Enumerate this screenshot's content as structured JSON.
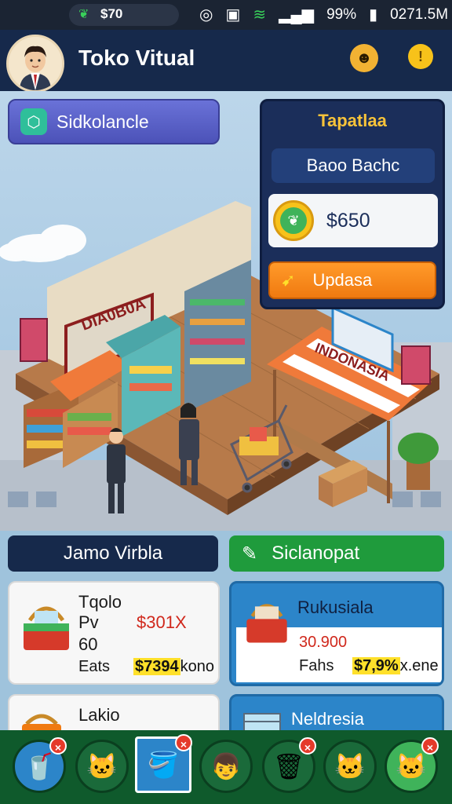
{
  "status_bar": {
    "left_text": "$70",
    "right_text": "99%",
    "time_text": "0271.5M"
  },
  "header": {
    "title": "Toko Vitual",
    "avatar_icon": "businessman-avatar",
    "icon1": "mascot-icon",
    "icon2": "info-icon"
  },
  "top_button": {
    "label": "Sidkolancle",
    "icon": "cube-icon"
  },
  "panel": {
    "title": "Tapatlaa",
    "subtitle": "Baoo Bachc",
    "amount": "$650",
    "button_label": "Updasa",
    "coin_icon": "leaf-coin-icon",
    "button_icon": "upgrade-arrow-icon"
  },
  "scene": {
    "store_sign": "DIA0B0A",
    "stall_sign": "INDONASIA"
  },
  "sections": {
    "left_title": "Jamo Virbla",
    "right_title": "Siclanopat",
    "right_icon": "pencil-icon"
  },
  "cards": [
    {
      "name": "Tqolo",
      "row2_label": "Pv",
      "row2_value": "$301X",
      "row3_label": "60",
      "row4_label": "Eats",
      "price": "$7394",
      "price_suffix": "kono"
    },
    {
      "name": "Rukusiala",
      "value": "30.900",
      "row_label": "Fahs",
      "price": "$7,9%",
      "price_suffix": "x.ene"
    },
    {
      "name": "Lakio"
    },
    {
      "name": "Neldresia"
    }
  ],
  "bottom_nav": [
    {
      "icon": "cup-icon",
      "bg": "#2c85c9",
      "glyph": "🥤"
    },
    {
      "icon": "cat-face-icon",
      "bg": "#1a6a3a",
      "glyph": "🐱"
    },
    {
      "icon": "bucket-icon",
      "bg": "#2c85c9",
      "glyph": "🪣"
    },
    {
      "icon": "character-icon",
      "bg": "#1a6a3a",
      "glyph": "👦"
    },
    {
      "icon": "trash-bin-icon",
      "bg": "#1a6a3a",
      "glyph": "🗑"
    },
    {
      "icon": "cat-face-icon",
      "bg": "#1a6a3a",
      "glyph": "🐱"
    },
    {
      "icon": "cat-face-icon",
      "bg": "#3fb35a",
      "glyph": "🐱"
    }
  ],
  "colors": {
    "header_bg": "#16294b",
    "accent_orange": "#f07a10",
    "accent_green": "#1f9b3c",
    "price_highlight": "#ffe02a"
  }
}
